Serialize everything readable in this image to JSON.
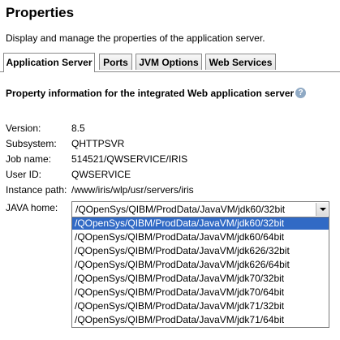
{
  "page": {
    "title": "Properties",
    "description": "Display and manage the properties of the application server."
  },
  "tabs": [
    {
      "label": "Application Server",
      "active": true
    },
    {
      "label": "Ports",
      "active": false
    },
    {
      "label": "JVM Options",
      "active": false
    },
    {
      "label": "Web Services",
      "active": false
    }
  ],
  "panel": {
    "heading": "Property information for the integrated Web application server",
    "help_icon": "question-mark"
  },
  "properties": [
    {
      "label": "Version:",
      "value": "8.5"
    },
    {
      "label": "Subsystem:",
      "value": "QHTTPSVR"
    },
    {
      "label": "Job name:",
      "value": "514521/QWSERVICE/IRIS"
    },
    {
      "label": "User ID:",
      "value": "QWSERVICE"
    },
    {
      "label": "Instance path:",
      "value": "/www/iris/wlp/usr/servers/iris"
    }
  ],
  "java_home": {
    "label": "JAVA home:",
    "selected": "/QOpenSys/QIBM/ProdData/JavaVM/jdk60/32bit",
    "options": [
      "/QOpenSys/QIBM/ProdData/JavaVM/jdk60/32bit",
      "/QOpenSys/QIBM/ProdData/JavaVM/jdk60/64bit",
      "/QOpenSys/QIBM/ProdData/JavaVM/jdk626/32bit",
      "/QOpenSys/QIBM/ProdData/JavaVM/jdk626/64bit",
      "/QOpenSys/QIBM/ProdData/JavaVM/jdk70/32bit",
      "/QOpenSys/QIBM/ProdData/JavaVM/jdk70/64bit",
      "/QOpenSys/QIBM/ProdData/JavaVM/jdk71/32bit",
      "/QOpenSys/QIBM/ProdData/JavaVM/jdk71/64bit"
    ]
  }
}
